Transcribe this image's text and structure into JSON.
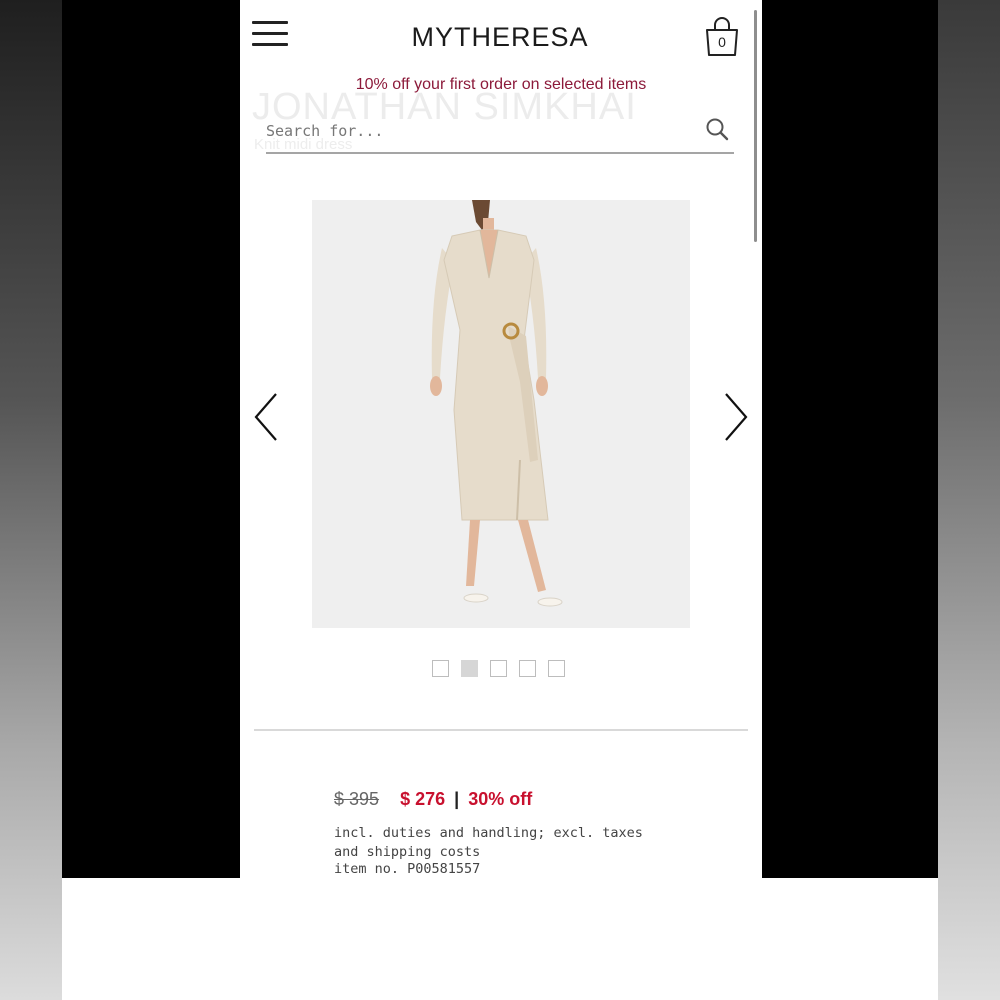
{
  "header": {
    "logo": "MYTHERESA",
    "bag_count": "0"
  },
  "promo": {
    "text": "10% off your first order on selected items"
  },
  "background_text": {
    "brand": "JONATHAN SIMKHAI",
    "product_name": "Knit midi dress"
  },
  "search": {
    "placeholder": "Search for..."
  },
  "gallery": {
    "total_images": 5,
    "active_index": 2
  },
  "pricing": {
    "original_price": "$ 395",
    "sale_price": "$ 276",
    "separator": "|",
    "discount": "30% off",
    "note": "incl. duties and handling; excl. taxes and shipping costs",
    "item_number": "item no. P00581557"
  },
  "colors": {
    "promo": "#8c1a3a",
    "sale": "#c8102e",
    "dress": "#e6dccb"
  },
  "icons": {
    "menu": "hamburger-menu-icon",
    "bag": "shopping-bag-icon",
    "search": "search-icon",
    "prev": "chevron-left-icon",
    "next": "chevron-right-icon"
  }
}
